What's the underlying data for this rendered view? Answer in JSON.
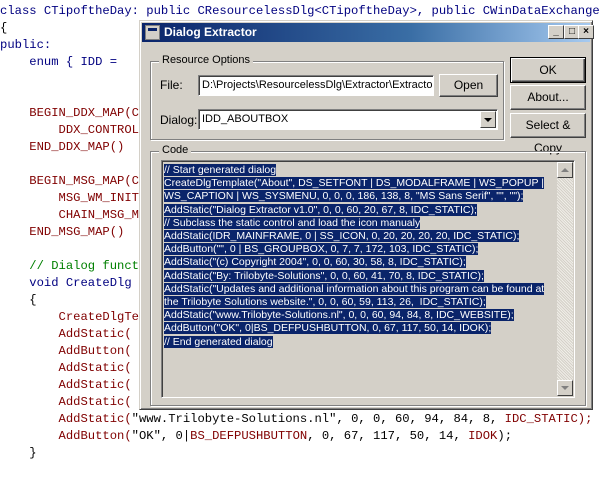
{
  "editor": {
    "lines": [
      [
        {
          "t": "class CTipoftheDay: public CResourcelessDlg<CTipoftheDay>, public CWinDataExchange",
          "c": "kw"
        }
      ],
      [
        {
          "t": "{",
          "c": "pl"
        }
      ],
      [
        {
          "t": "public:",
          "c": "kw"
        }
      ],
      [
        {
          "t": "    enum { IDD = ",
          "c": "kw"
        }
      ],
      [
        {
          "t": "",
          "c": "pl"
        }
      ],
      [
        {
          "t": "",
          "c": "pl"
        }
      ],
      [
        {
          "t": "    BEGIN_DDX_MAP(CTipoftheDay)",
          "c": "mac"
        }
      ],
      [
        {
          "t": "        DDX_CONTROL(",
          "c": "mac"
        }
      ],
      [
        {
          "t": "    END_DDX_MAP()",
          "c": "mac"
        }
      ],
      [
        {
          "t": "",
          "c": "pl"
        }
      ],
      [
        {
          "t": "    BEGIN_MSG_MAP(CTipoftheDay)",
          "c": "mac"
        }
      ],
      [
        {
          "t": "        MSG_WM_INITDIALOG(",
          "c": "mac"
        }
      ],
      [
        {
          "t": "        CHAIN_MSG_MAP(",
          "c": "mac"
        }
      ],
      [
        {
          "t": "    END_MSG_MAP()",
          "c": "mac"
        }
      ],
      [
        {
          "t": "",
          "c": "pl"
        }
      ],
      [
        {
          "t": "    // Dialog functions",
          "c": "cm"
        }
      ],
      [
        {
          "t": "    void CreateDlg",
          "c": "kw"
        }
      ],
      [
        {
          "t": "    {",
          "c": "pl"
        }
      ],
      [
        {
          "t": "        CreateDlgTemplate(",
          "c": "mac"
        }
      ],
      [
        {
          "t": "        AddStatic(",
          "c": "mac"
        }
      ],
      [
        {
          "t": "        AddButton(",
          "c": "mac"
        }
      ],
      [
        {
          "t": "        AddStatic(",
          "c": "mac"
        }
      ],
      [
        {
          "t": "        AddStatic(",
          "c": "mac"
        }
      ],
      [
        {
          "t": "        AddStatic(",
          "c": "mac"
        }
      ],
      [
        {
          "t": "        AddStatic(",
          "c": "mac"
        },
        {
          "t": "\"www.Trilobyte-Solutions.nl\", 0, 0, 60, 94, 84, 8, ",
          "c": "pl"
        },
        {
          "t": "IDC_STATIC);",
          "c": "mac"
        }
      ],
      [
        {
          "t": "        AddButton(",
          "c": "mac"
        },
        {
          "t": "\"OK\", 0|",
          "c": "pl"
        },
        {
          "t": "BS_DEFPUSHBUTTON",
          "c": "mac"
        },
        {
          "t": ", 0, 67, 117, 50, 14, ",
          "c": "pl"
        },
        {
          "t": "IDOK",
          "c": "mac"
        },
        {
          "t": ");",
          "c": "pl"
        }
      ],
      [
        {
          "t": "    }",
          "c": "pl"
        }
      ]
    ]
  },
  "dialog": {
    "title": "Dialog Extractor",
    "caption_buttons": {
      "minimize": "_",
      "maximize": "□",
      "close": "×"
    },
    "resource_group": {
      "legend": "Resource Options",
      "file_label": "File:",
      "file_value": "D:\\Projects\\ResourcelessDlg\\Extractor\\Extractor.rc",
      "open_button": "Open",
      "dialog_label": "Dialog:",
      "dialog_value": "IDD_ABOUTBOX"
    },
    "buttons": {
      "ok": "OK",
      "about": "About...",
      "select_copy": "Select & Copy"
    },
    "code_group": {
      "legend": "Code",
      "lines": [
        "// Start generated dialog",
        "CreateDlgTemplate(\"About\", DS_SETFONT | DS_MODALFRAME | WS_POPUP |",
        "WS_CAPTION | WS_SYSMENU, 0, 0, 0, 186, 138, 8, \"MS Sans Serif\", \"\", \"\");",
        "AddStatic(\"Dialog Extractor v1.0\", 0, 0, 60, 20, 67, 8, IDC_STATIC);",
        "// Subclass the static control and load the icon manualy",
        "AddStatic(IDR_MAINFRAME, 0 | SS_ICON, 0, 20, 20, 20, 20, IDC_STATIC);",
        "AddButton(\"\", 0 | BS_GROUPBOX, 0, 7, 7, 172, 103, IDC_STATIC);",
        "AddStatic(\"(c) Copyright 2004\", 0, 0, 60, 30, 58, 8, IDC_STATIC);",
        "AddStatic(\"By: Trilobyte-Solutions\", 0, 0, 60, 41, 70, 8, IDC_STATIC);",
        "AddStatic(\"Updates and additional information about this program can be found at",
        "the Trilobyte Solutions website.\", 0, 0, 60, 59, 113, 26,  IDC_STATIC);",
        "AddStatic(\"www.Trilobyte-Solutions.nl\", 0, 0, 60, 94, 84, 8, IDC_WEBSITE);",
        "AddButton(\"OK\", 0|BS_DEFPUSHBUTTON, 0, 67, 117, 50, 14, IDOK);",
        "// End generated dialog"
      ]
    }
  }
}
